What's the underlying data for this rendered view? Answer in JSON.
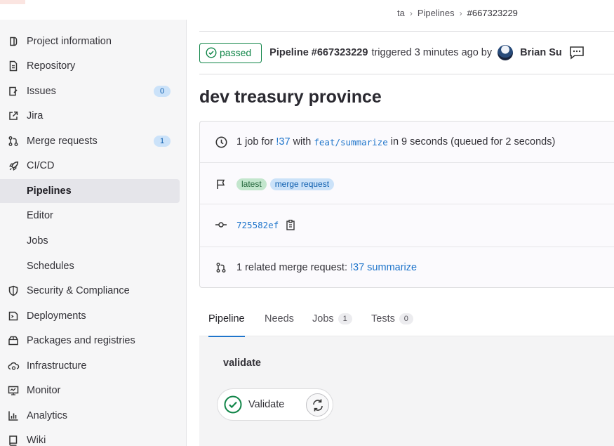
{
  "sidebar": {
    "items": [
      {
        "label": "Project information",
        "icon": "project-icon"
      },
      {
        "label": "Repository",
        "icon": "repository-icon"
      },
      {
        "label": "Issues",
        "icon": "issues-icon",
        "badge": "0"
      },
      {
        "label": "Jira",
        "icon": "external-link-icon"
      },
      {
        "label": "Merge requests",
        "icon": "merge-request-icon",
        "badge": "1"
      },
      {
        "label": "CI/CD",
        "icon": "rocket-icon"
      },
      {
        "label": "Pipelines"
      },
      {
        "label": "Editor"
      },
      {
        "label": "Jobs"
      },
      {
        "label": "Schedules"
      },
      {
        "label": "Security & Compliance",
        "icon": "shield-icon"
      },
      {
        "label": "Deployments",
        "icon": "deployments-icon"
      },
      {
        "label": "Packages and registries",
        "icon": "package-icon"
      },
      {
        "label": "Infrastructure",
        "icon": "cloud-gear-icon"
      },
      {
        "label": "Monitor",
        "icon": "monitor-icon"
      },
      {
        "label": "Analytics",
        "icon": "chart-icon"
      },
      {
        "label": "Wiki",
        "icon": "book-icon"
      }
    ]
  },
  "breadcrumb": {
    "project": "ta",
    "section": "Pipelines",
    "current": "#667323229"
  },
  "header": {
    "status": "passed",
    "pipeline": "Pipeline #667323229",
    "triggered": "triggered 3 minutes ago by",
    "user": "Brian Su"
  },
  "title": "dev treasury province",
  "info": {
    "job_prefix": "1 job for",
    "mr_ref": "!37",
    "with": "with",
    "branch": "feat/summarize",
    "duration": "in 9 seconds (queued for 2 seconds)",
    "tag_latest": "latest",
    "tag_mr": "merge request",
    "commit": "725582ef",
    "related_prefix": "1 related merge request:",
    "related_link": "!37 summarize"
  },
  "tabs": {
    "pipeline": "Pipeline",
    "needs": "Needs",
    "jobs": "Jobs",
    "jobs_count": "1",
    "tests": "Tests",
    "tests_count": "0"
  },
  "graph": {
    "stage": "validate",
    "job": "Validate"
  },
  "colors": {
    "success": "#108548",
    "link": "#1f75cb",
    "active_tab": "#1f75cb"
  }
}
